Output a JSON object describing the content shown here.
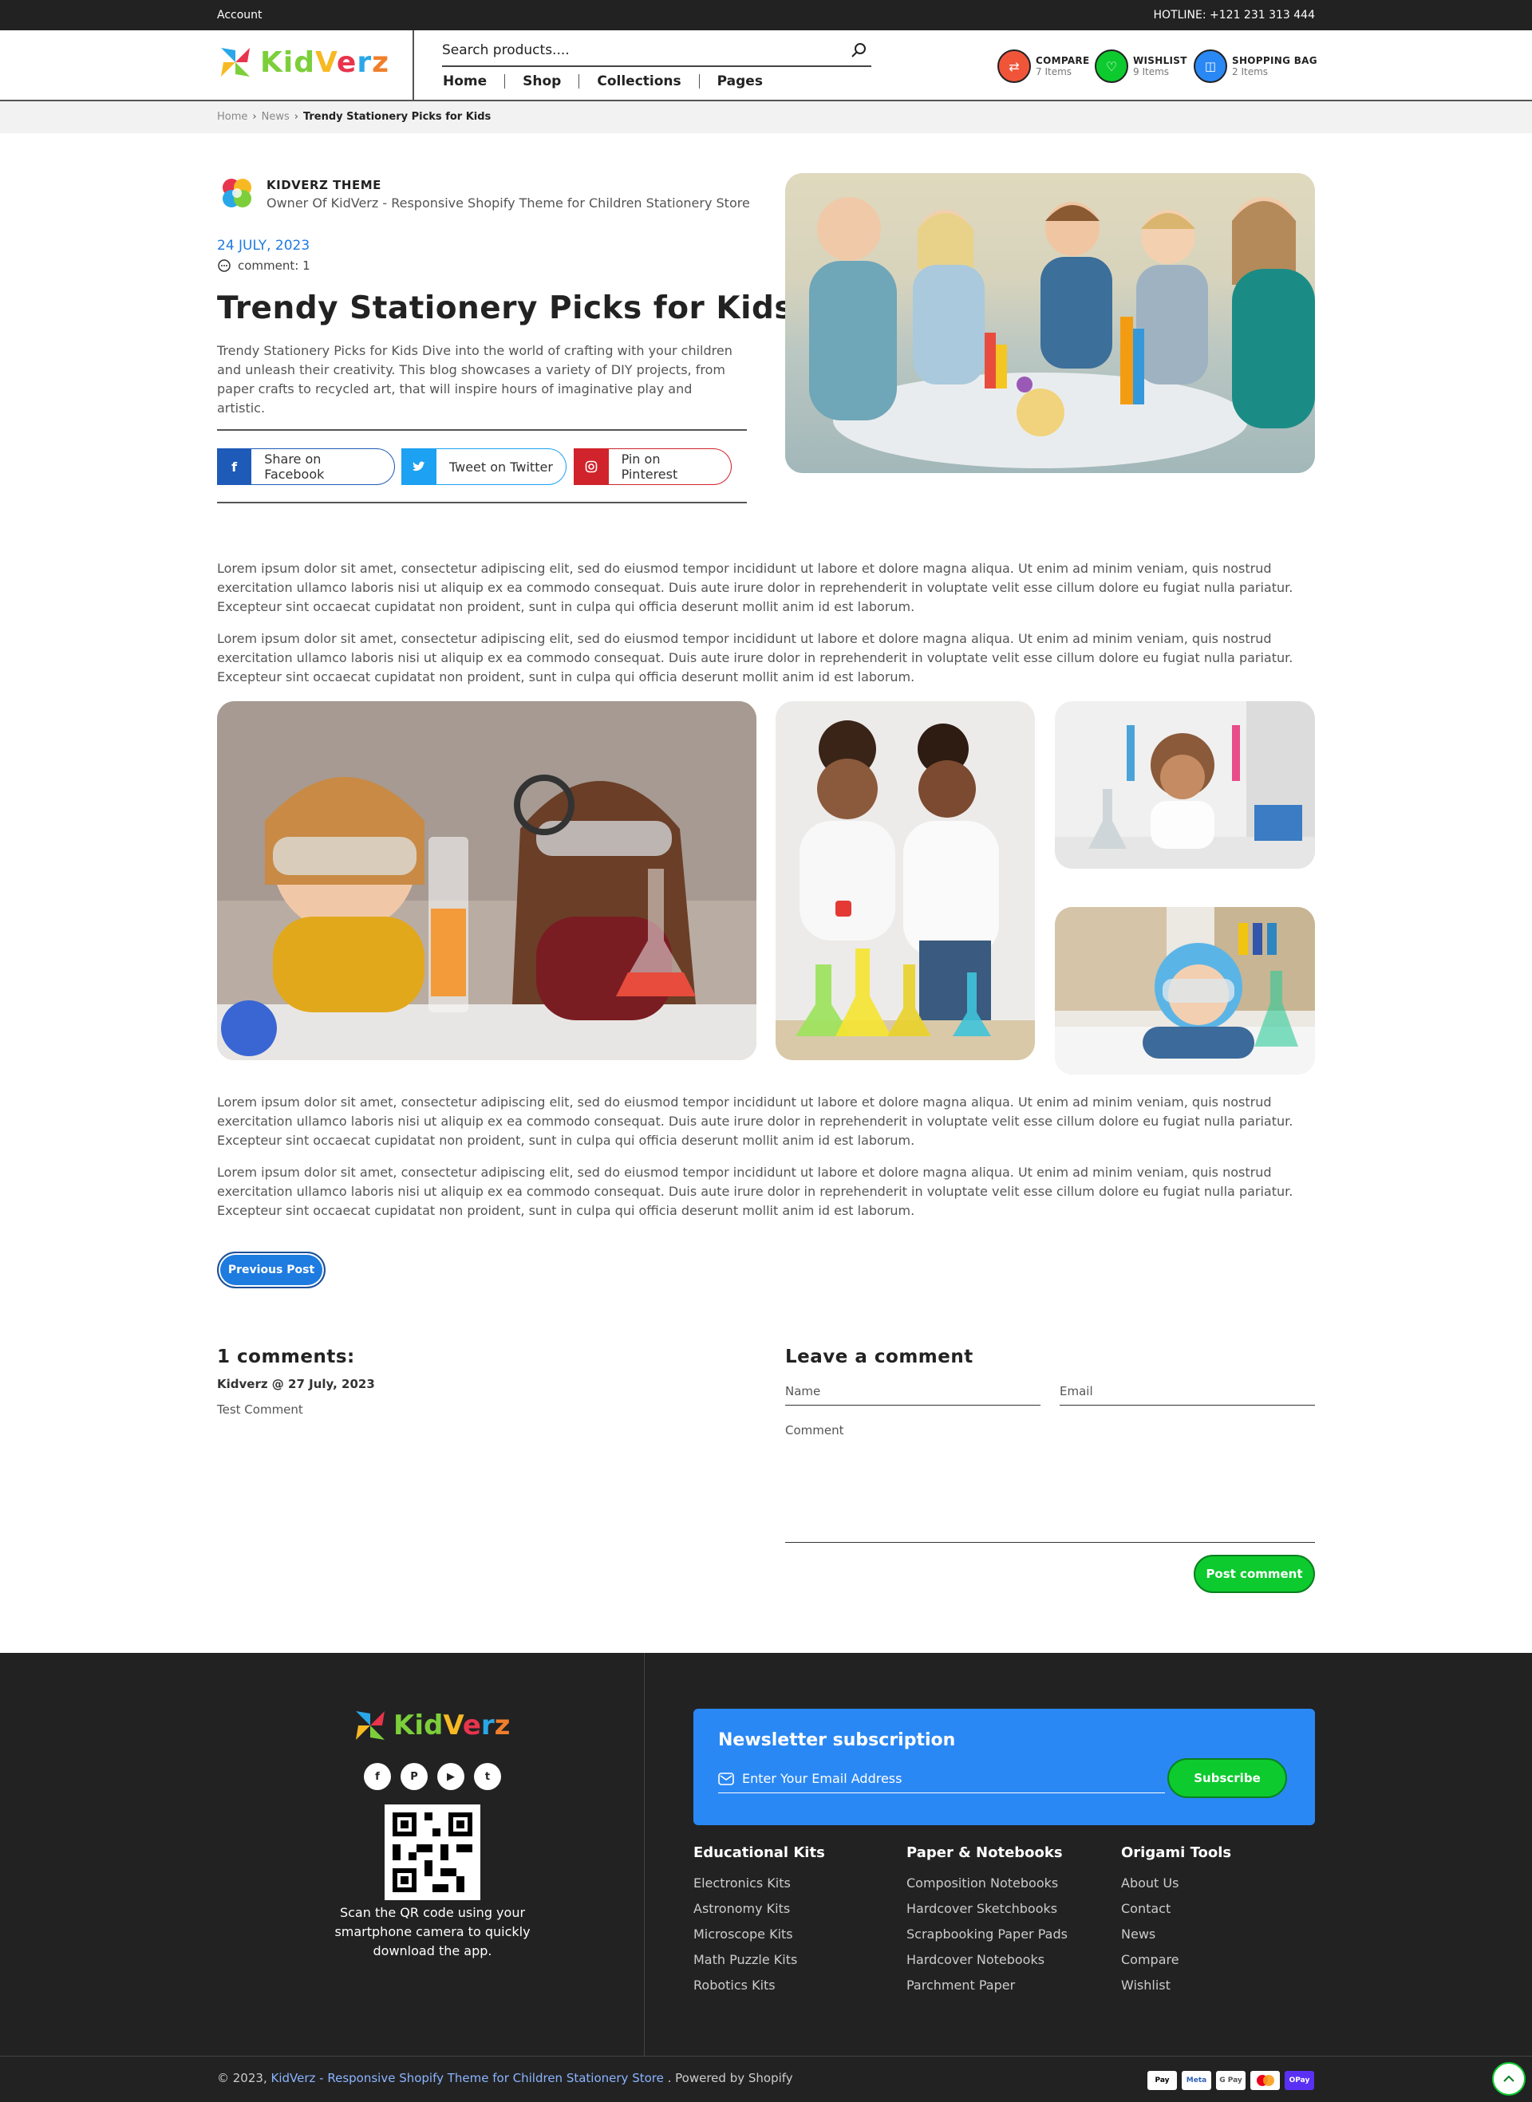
{
  "topbar": {
    "account": "Account",
    "hotline": "HOTLINE: +121 231 313 444"
  },
  "header": {
    "logo_text": "KidVerz",
    "search_placeholder": "Search products....",
    "nav": [
      "Home",
      "Shop",
      "Collections",
      "Pages"
    ],
    "compare": {
      "label": "COMPARE",
      "count": "7 Items",
      "color": "#f0553a"
    },
    "wishlist": {
      "label": "WISHLIST",
      "count": "9 Items",
      "color": "#0dca2e"
    },
    "bag": {
      "label": "SHOPPING BAG",
      "count": "2 Items",
      "color": "#2a88f4"
    }
  },
  "breadcrumb": {
    "home": "Home",
    "news": "News",
    "current": "Trendy Stationery Picks for Kids"
  },
  "article": {
    "author_name": "KIDVERZ THEME",
    "author_role": "Owner Of KidVerz - Responsive Shopify Theme for Children Stationery Store",
    "date": "24 JULY, 2023",
    "comments": "comment: 1",
    "title": "Trendy Stationery Picks for Kids",
    "intro": "Trendy Stationery Picks for Kids Dive into the world of crafting with your children and unleash their creativity. This blog showcases a variety of DIY projects, from paper crafts to recycled art, that will inspire hours of imaginative play and artistic.",
    "share": [
      {
        "label": "Share on Facebook",
        "icon": "facebook-icon",
        "color": "#1e5bb8"
      },
      {
        "label": "Tweet on Twitter",
        "icon": "twitter-icon",
        "color": "#1da1f2"
      },
      {
        "label": "Pin on Pinterest",
        "icon": "instagram-icon",
        "color": "#d0232b"
      }
    ],
    "paragraphs": [
      "Lorem ipsum dolor sit amet, consectetur adipiscing elit, sed do eiusmod tempor incididunt ut labore et dolore magna aliqua. Ut enim ad minim veniam, quis nostrud exercitation ullamco laboris nisi ut aliquip ex ea commodo consequat. Duis aute irure dolor in reprehenderit in voluptate velit esse cillum dolore eu fugiat nulla pariatur. Excepteur sint occaecat cupidatat non proident, sunt in culpa qui officia deserunt mollit anim id est laborum.",
      "Lorem ipsum dolor sit amet, consectetur adipiscing elit, sed do eiusmod tempor incididunt ut labore et dolore magna aliqua. Ut enim ad minim veniam, quis nostrud exercitation ullamco laboris nisi ut aliquip ex ea commodo consequat. Duis aute irure dolor in reprehenderit in voluptate velit esse cillum dolore eu fugiat nulla pariatur. Excepteur sint occaecat cupidatat non proident, sunt in culpa qui officia deserunt mollit anim id est laborum.",
      "Lorem ipsum dolor sit amet, consectetur adipiscing elit, sed do eiusmod tempor incididunt ut labore et dolore magna aliqua. Ut enim ad minim veniam, quis nostrud exercitation ullamco laboris nisi ut aliquip ex ea commodo consequat. Duis aute irure dolor in reprehenderit in voluptate velit esse cillum dolore eu fugiat nulla pariatur. Excepteur sint occaecat cupidatat non proident, sunt in culpa qui officia deserunt mollit anim id est laborum.",
      "Lorem ipsum dolor sit amet, consectetur adipiscing elit, sed do eiusmod tempor incididunt ut labore et dolore magna aliqua. Ut enim ad minim veniam, quis nostrud exercitation ullamco laboris nisi ut aliquip ex ea commodo consequat. Duis aute irure dolor in reprehenderit in voluptate velit esse cillum dolore eu fugiat nulla pariatur. Excepteur sint occaecat cupidatat non proident, sunt in culpa qui officia deserunt mollit anim id est laborum."
    ],
    "prev_button": "Previous Post"
  },
  "comments": {
    "heading": "1 comments:",
    "author": "Kidverz @ 27 July, 2023",
    "text": "Test Comment"
  },
  "form": {
    "heading": "Leave a comment",
    "name": "Name",
    "email": "Email",
    "comment": "Comment",
    "submit": "Post comment"
  },
  "footer": {
    "logo_text": "KidVerz",
    "social": [
      "facebook-icon",
      "pinterest-icon",
      "youtube-icon",
      "twitter-icon"
    ],
    "qr_text": "Scan the QR code using your smartphone camera to quickly download the app.",
    "newsletter_title": "Newsletter subscription",
    "newsletter_placeholder": "Enter Your Email Address",
    "subscribe": "Subscribe",
    "cols": [
      {
        "heading": "Educational Kits",
        "links": [
          "Electronics Kits",
          "Astronomy Kits",
          "Microscope Kits",
          "Math Puzzle Kits",
          "Robotics Kits"
        ]
      },
      {
        "heading": "Paper & Notebooks",
        "links": [
          "Composition Notebooks",
          "Hardcover Sketchbooks",
          "Scrapbooking Paper Pads",
          "Hardcover Notebooks",
          "Parchment Paper"
        ]
      },
      {
        "heading": "Origami Tools",
        "links": [
          "About Us",
          "Contact",
          "News",
          "Compare",
          "Wishlist"
        ]
      }
    ],
    "copyright_prefix": "© 2023,",
    "copyright_brand": "KidVerz - Responsive Shopify Theme for Children Stationery Store",
    "copyright_suffix": ". Powered by Shopify",
    "payments": [
      "Pay",
      "Meta",
      "G Pay",
      "",
      "OPay"
    ]
  }
}
